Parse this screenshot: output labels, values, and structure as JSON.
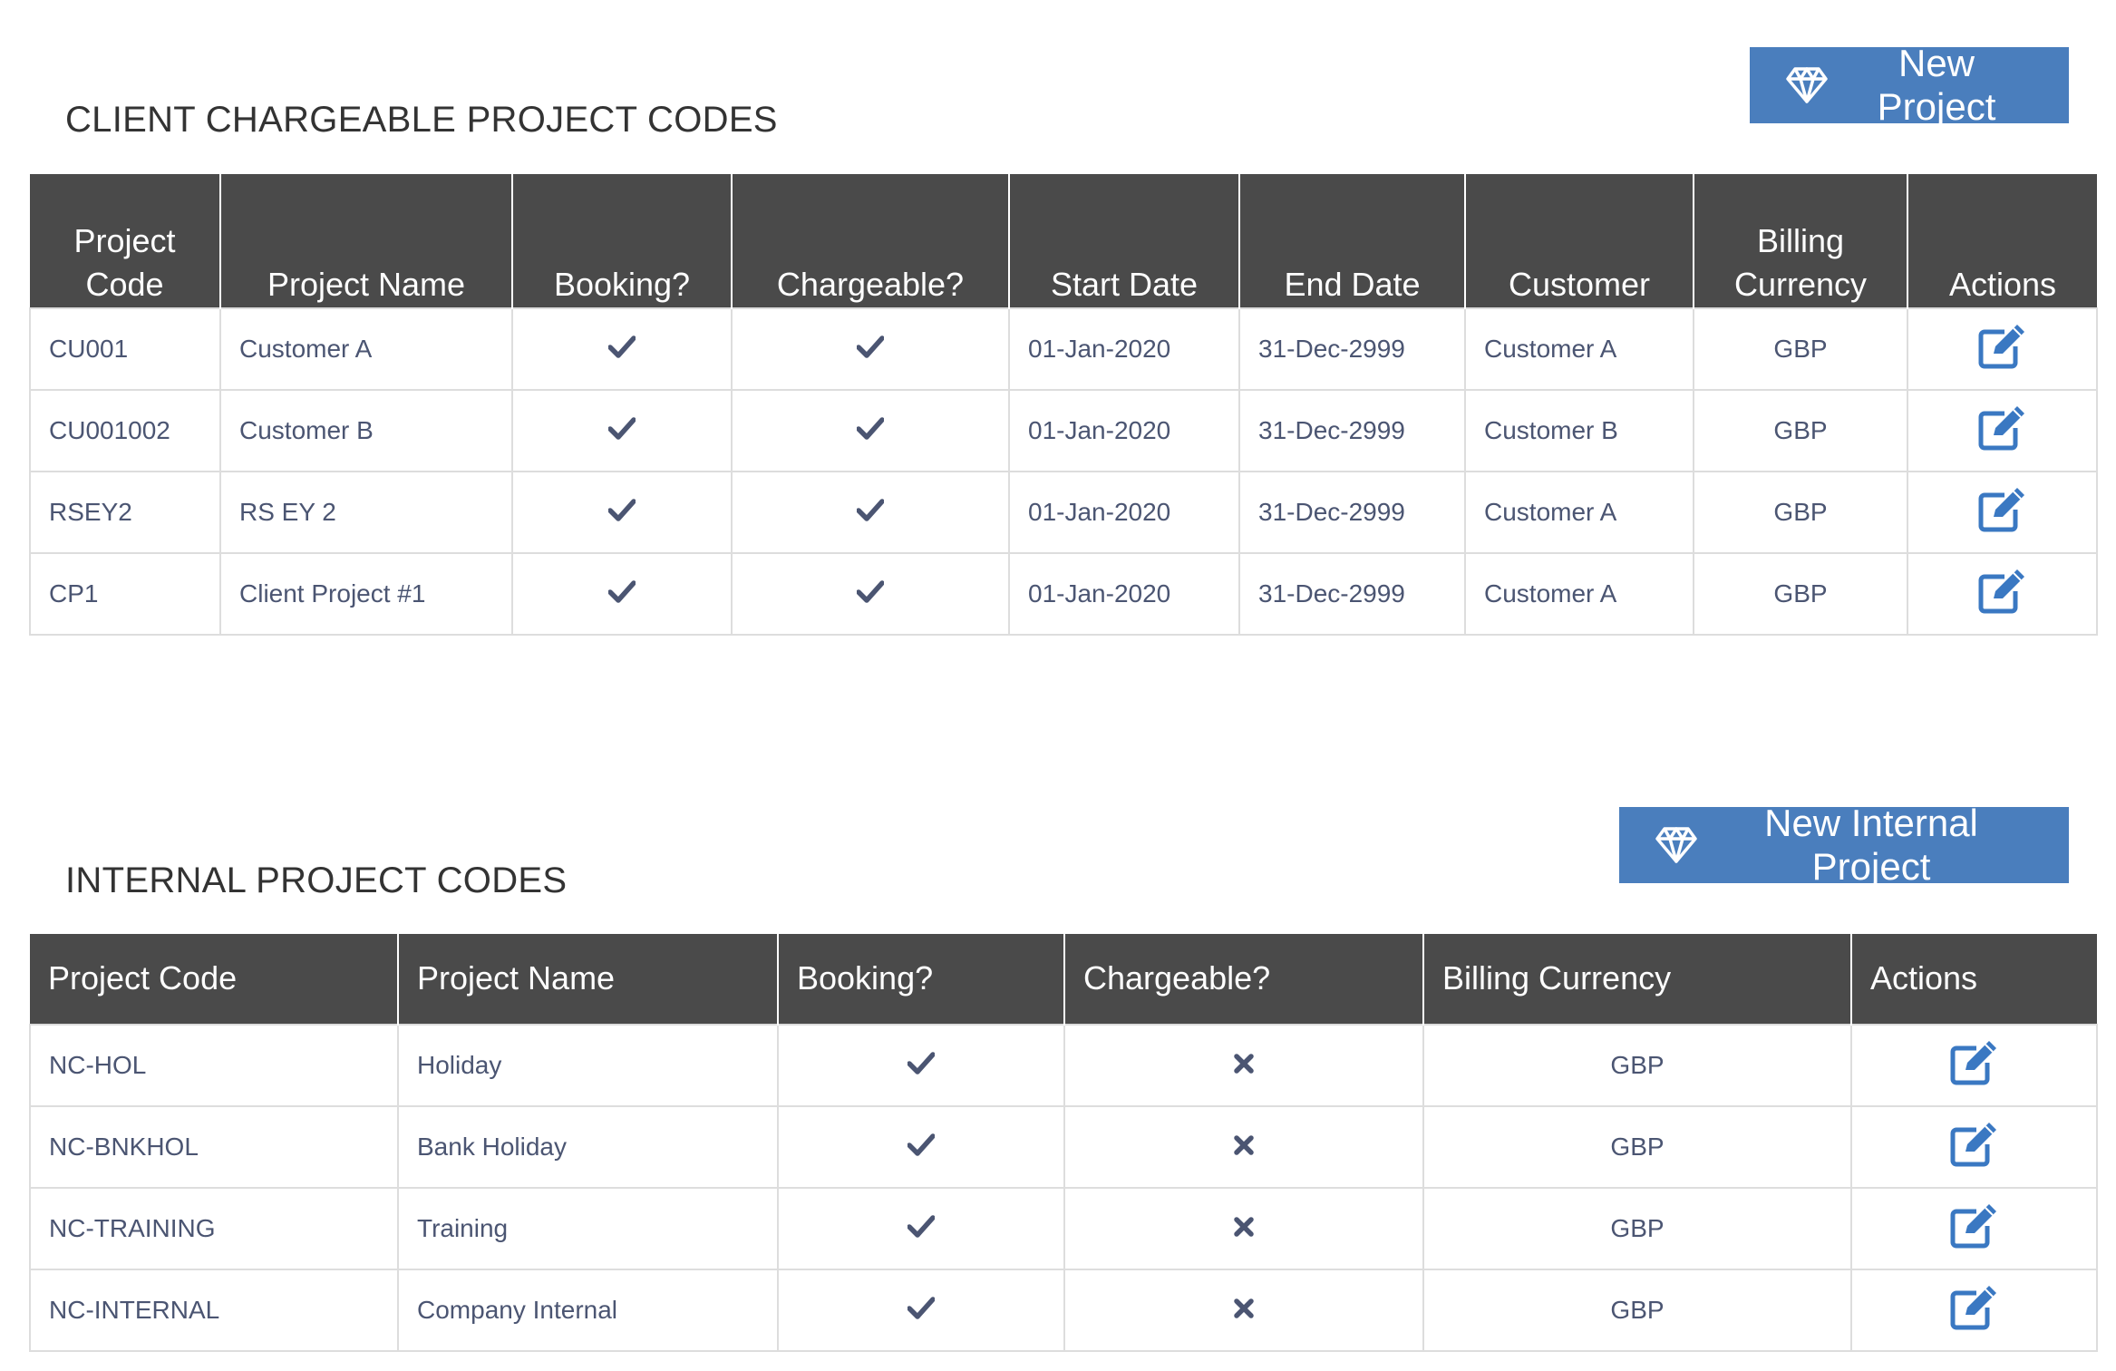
{
  "client_section": {
    "title": "CLIENT CHARGEABLE PROJECT CODES",
    "button_label": "New Project",
    "button_icon": "diamond-icon",
    "columns": [
      "Project Code",
      "Project Name",
      "Booking?",
      "Chargeable?",
      "Start Date",
      "End Date",
      "Customer",
      "Billing Currency",
      "Actions"
    ],
    "rows": [
      {
        "code": "CU001",
        "name": "Customer A",
        "booking": true,
        "chargeable": true,
        "start": "01-Jan-2020",
        "end": "31-Dec-2999",
        "customer": "Customer A",
        "currency": "GBP"
      },
      {
        "code": "CU001002",
        "name": "Customer B",
        "booking": true,
        "chargeable": true,
        "start": "01-Jan-2020",
        "end": "31-Dec-2999",
        "customer": "Customer B",
        "currency": "GBP"
      },
      {
        "code": "RSEY2",
        "name": "RS EY 2",
        "booking": true,
        "chargeable": true,
        "start": "01-Jan-2020",
        "end": "31-Dec-2999",
        "customer": "Customer A",
        "currency": "GBP"
      },
      {
        "code": "CP1",
        "name": "Client Project #1",
        "booking": true,
        "chargeable": true,
        "start": "01-Jan-2020",
        "end": "31-Dec-2999",
        "customer": "Customer A",
        "currency": "GBP"
      }
    ]
  },
  "internal_section": {
    "title": "INTERNAL PROJECT CODES",
    "button_label": "New Internal Project",
    "button_icon": "diamond-icon",
    "columns": [
      "Project Code",
      "Project Name",
      "Booking?",
      "Chargeable?",
      "Billing Currency",
      "Actions"
    ],
    "rows": [
      {
        "code": "NC-HOL",
        "name": "Holiday",
        "booking": true,
        "chargeable": false,
        "currency": "GBP"
      },
      {
        "code": "NC-BNKHOL",
        "name": "Bank Holiday",
        "booking": true,
        "chargeable": false,
        "currency": "GBP"
      },
      {
        "code": "NC-TRAINING",
        "name": "Training",
        "booking": true,
        "chargeable": false,
        "currency": "GBP"
      },
      {
        "code": "NC-INTERNAL",
        "name": "Company Internal",
        "booking": true,
        "chargeable": false,
        "currency": "GBP"
      }
    ]
  },
  "colors": {
    "header_bg": "#4a4a4a",
    "button_bg": "#4a7ebd",
    "icon_blue": "#3a78c2",
    "cell_text": "#4b5572",
    "border": "#dddddd"
  },
  "icons": {
    "check": "check-icon",
    "cross": "cross-icon",
    "edit": "edit-icon"
  }
}
